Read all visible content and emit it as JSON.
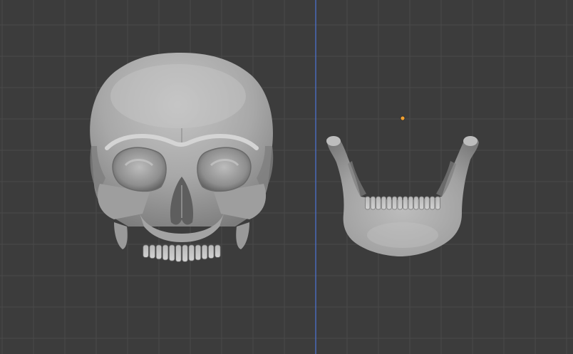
{
  "viewport": {
    "view": "front-orthographic",
    "grid_visible": true,
    "background_color": "#3c3c3c",
    "grid_color": "#4a4a4a",
    "z_axis_color": "#4a6ab8",
    "origin_color": "#f0a030"
  },
  "scene": {
    "objects": [
      {
        "name": "cranium",
        "material_color": "#a9a9a9"
      },
      {
        "name": "mandible",
        "material_color": "#a9a9a9"
      }
    ],
    "selected_origin_visible": true
  }
}
